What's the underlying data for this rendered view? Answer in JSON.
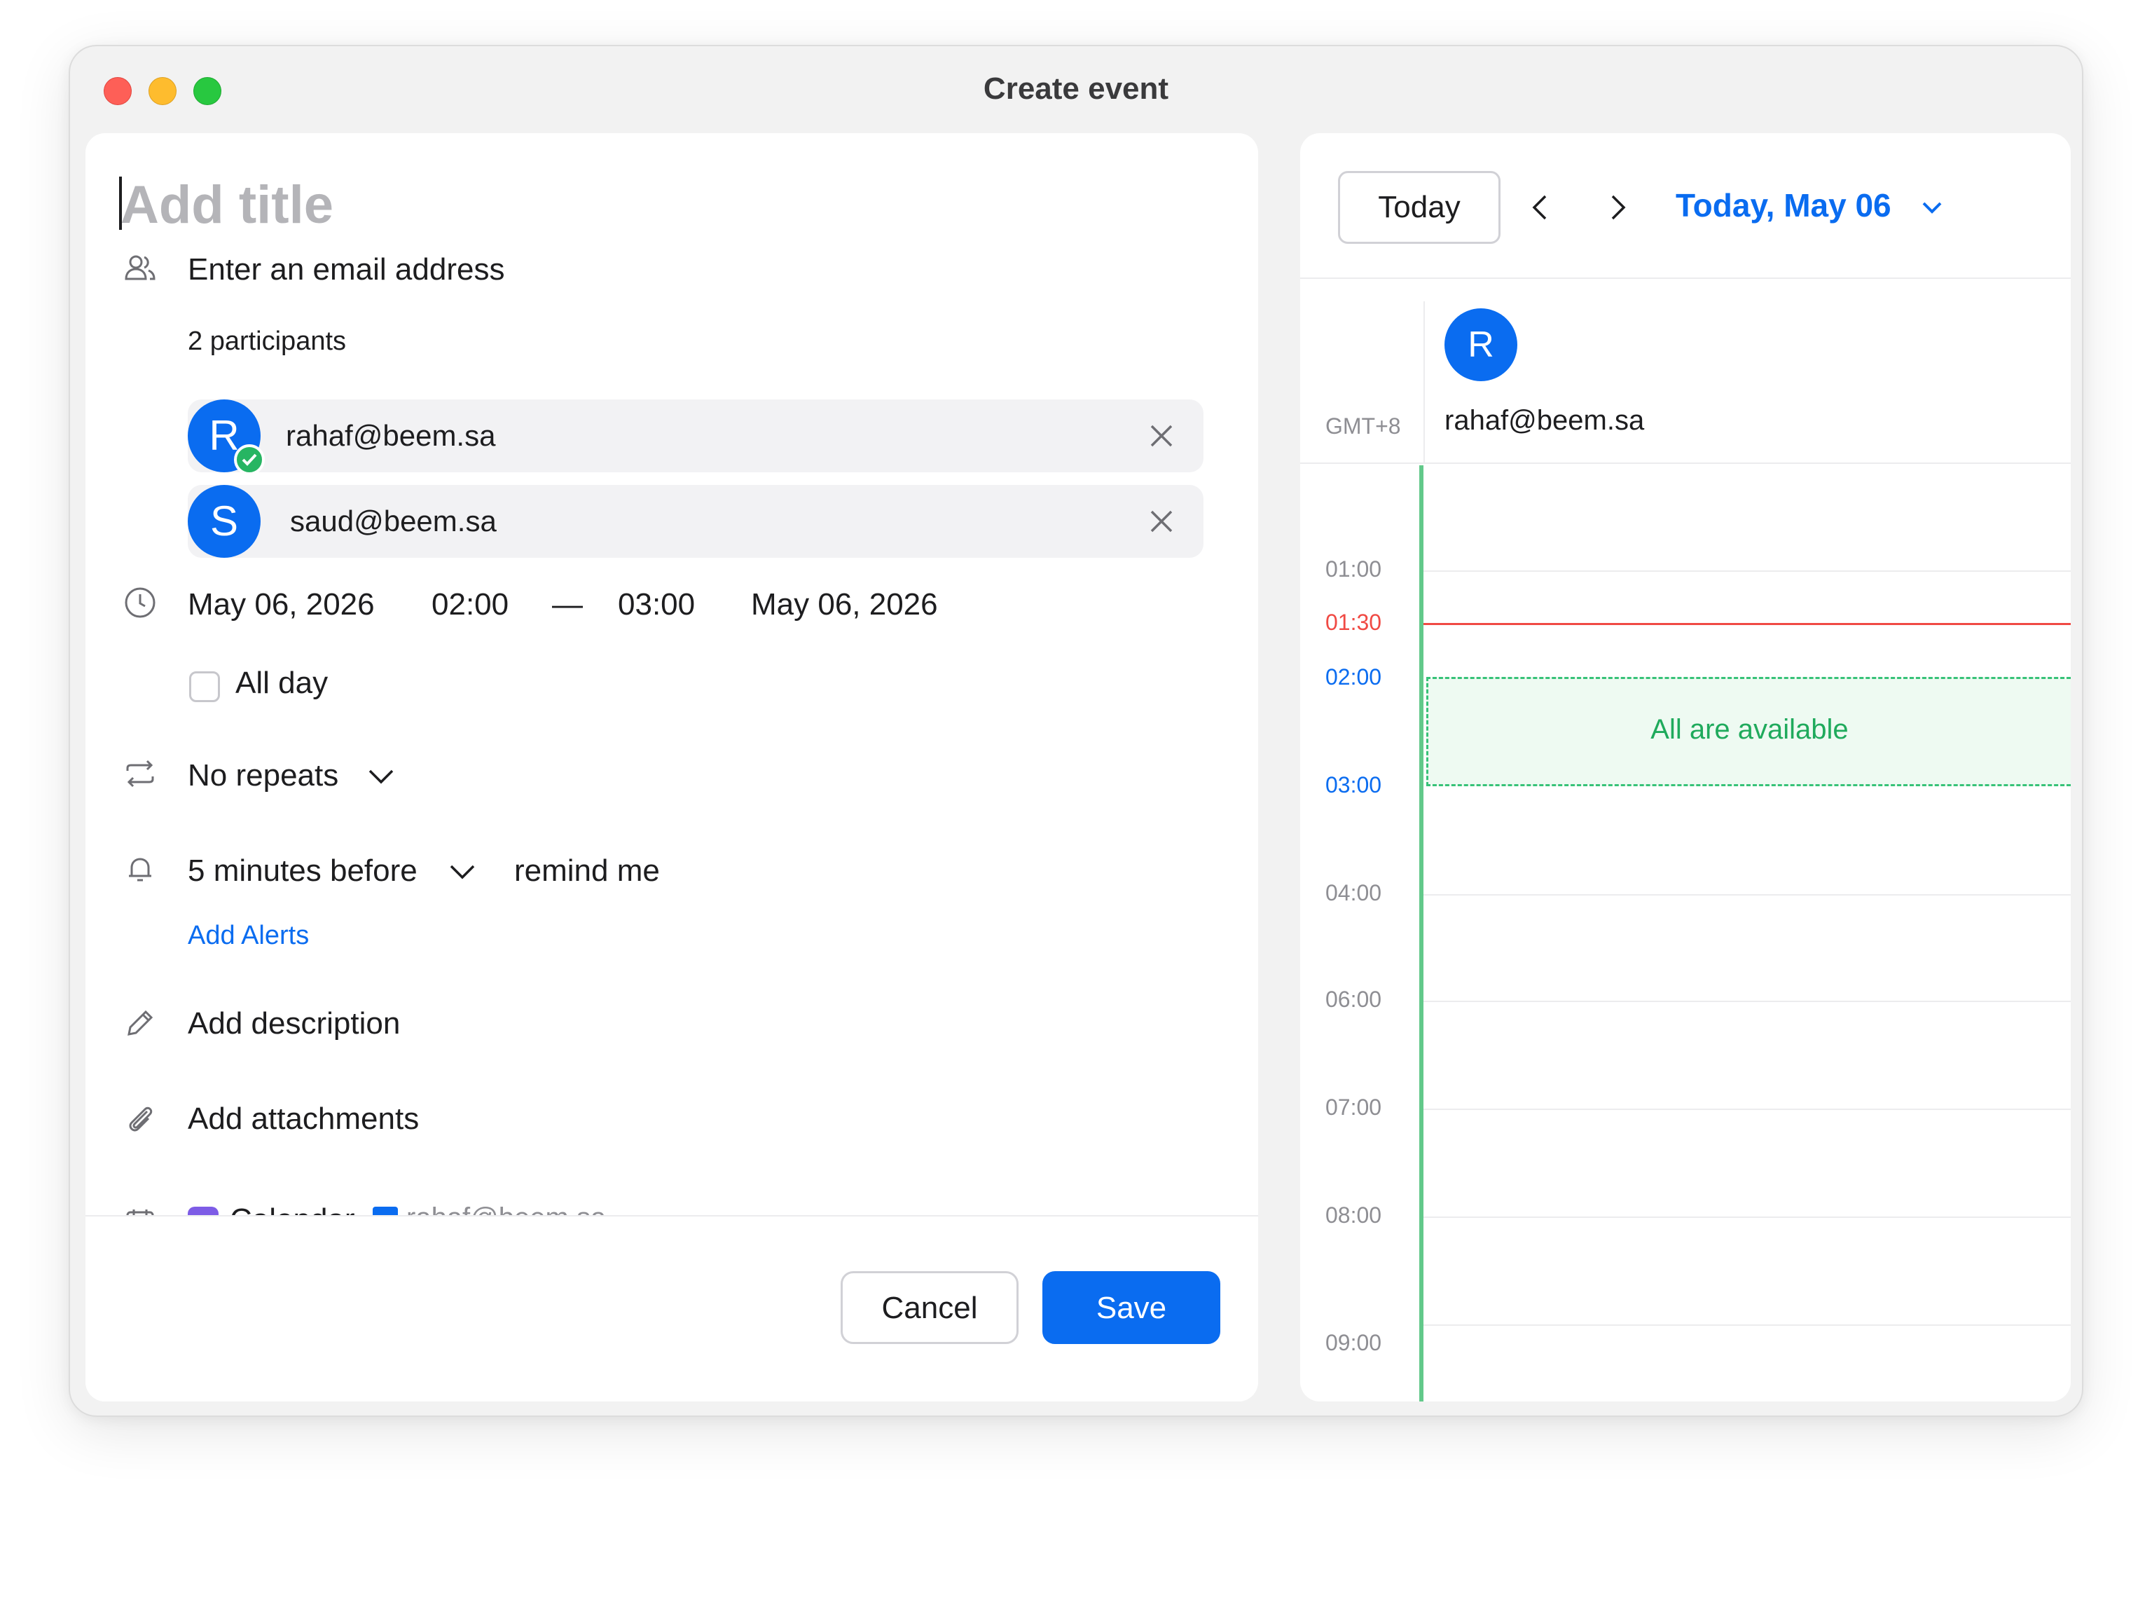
{
  "window": {
    "title": "Create event"
  },
  "form": {
    "title_placeholder": "Add title",
    "email_placeholder": "Enter an email address",
    "participants_count": "2 participants",
    "participants": [
      {
        "initial": "R",
        "email": "rahaf@beem.sa",
        "verified": true
      },
      {
        "initial": "S",
        "email": "saud@beem.sa",
        "verified": false
      }
    ],
    "start_date": "May 06, 2026",
    "start_time": "02:00",
    "separator": "—",
    "end_time": "03:00",
    "end_date": "May 06, 2026",
    "all_day_label": "All day",
    "repeat_label": "No repeats",
    "reminder_value": "5 minutes before",
    "reminder_suffix": "remind me",
    "add_alerts": "Add Alerts",
    "add_description": "Add description",
    "add_attachments": "Add attachments",
    "calendar_label": "Calendar",
    "calendar_account": "rahaf@beem.sa"
  },
  "footer": {
    "cancel": "Cancel",
    "save": "Save"
  },
  "calendar": {
    "today_button": "Today",
    "date_label": "Today, May 06",
    "timezone": "GMT+8",
    "attendee_initial": "R",
    "attendee_email": "rahaf@beem.sa",
    "hours": [
      "01:00",
      "04:00",
      "06:00",
      "07:00",
      "08:00",
      "09:00"
    ],
    "current_time": "01:30",
    "event_start": "02:00",
    "event_end": "03:00",
    "availability_text": "All are available"
  },
  "colors": {
    "accent": "#0a6cf0",
    "available": "#1faa5c",
    "now_line": "#f04a44",
    "calendar_swatch": "#7d5ce6"
  }
}
